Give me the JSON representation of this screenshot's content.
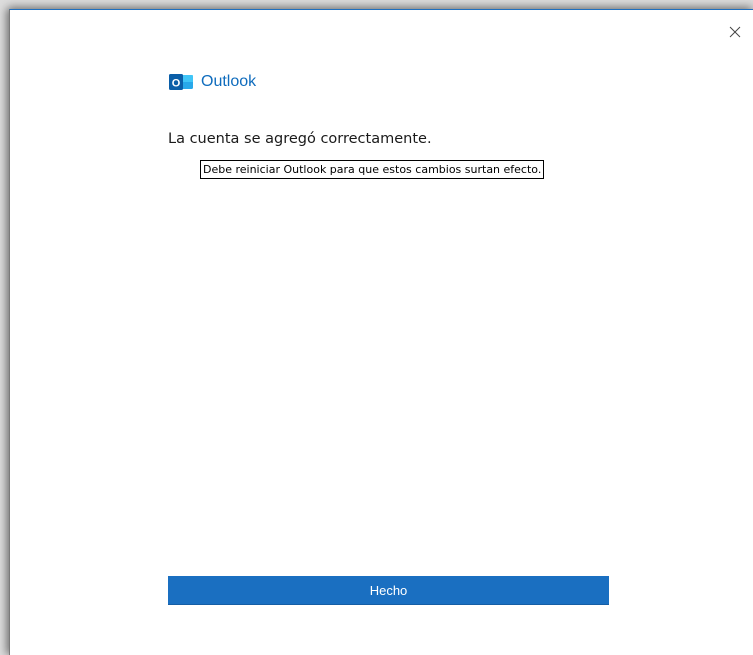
{
  "window": {
    "close_icon": "close-icon"
  },
  "brand": {
    "icon": "outlook-logo-icon",
    "logo_letter": "O",
    "name": "Outlook",
    "color": "#0f6cbd"
  },
  "content": {
    "headline": "La cuenta se agregó correctamente.",
    "restart_note": "Debe reiniciar Outlook para que estos cambios surtan efecto."
  },
  "actions": {
    "done_label": "Hecho",
    "done_color": "#1a6fc1"
  }
}
